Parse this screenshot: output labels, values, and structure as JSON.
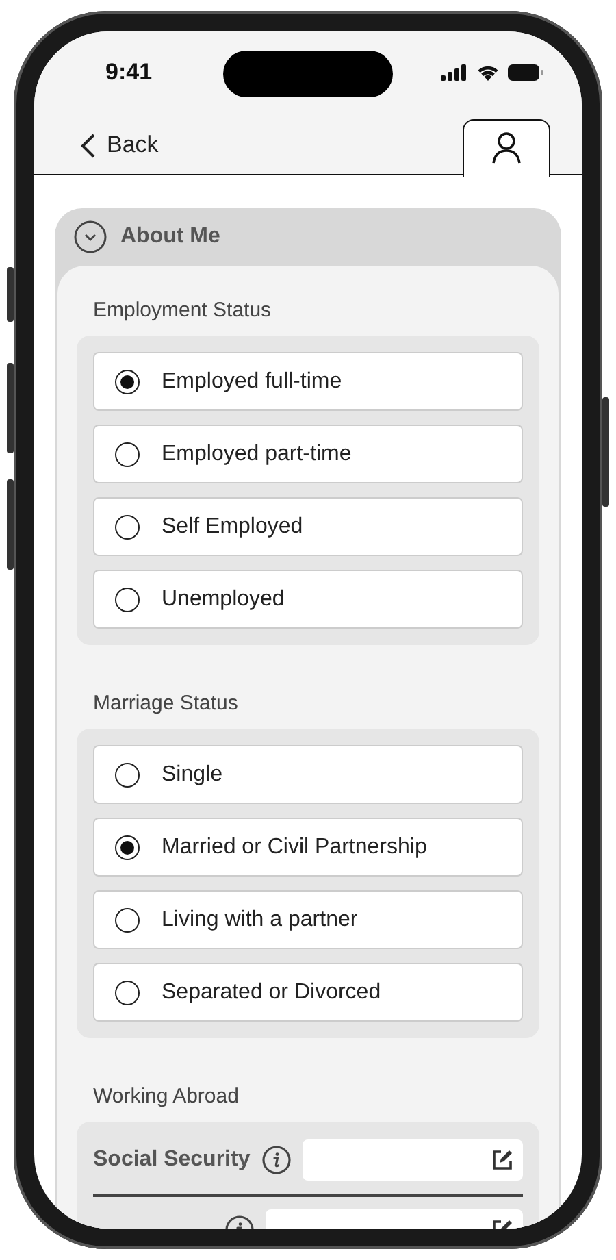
{
  "status_bar": {
    "time": "9:41"
  },
  "nav": {
    "back": "Back",
    "tabs": [
      {
        "kind": "profile",
        "selected": true
      }
    ]
  },
  "section": {
    "title": "About Me",
    "expanded": true,
    "groups": [
      {
        "title": "Employment Status",
        "options": [
          {
            "label": "Employed full-time",
            "selected": true
          },
          {
            "label": "Employed part-time",
            "selected": false
          },
          {
            "label": "Self Employed",
            "selected": false
          },
          {
            "label": "Unemployed",
            "selected": false
          }
        ]
      },
      {
        "title": "Marriage Status",
        "options": [
          {
            "label": "Single",
            "selected": false
          },
          {
            "label": "Married or Civil Partnership",
            "selected": true
          },
          {
            "label": "Living with a partner",
            "selected": false
          },
          {
            "label": "Separated or Divorced",
            "selected": false
          }
        ]
      }
    ],
    "working_abroad": {
      "title": "Working Abroad",
      "rows": [
        {
          "kind": "labeled",
          "label": "Social Security"
        },
        {
          "kind": "unlabeled"
        }
      ]
    }
  }
}
